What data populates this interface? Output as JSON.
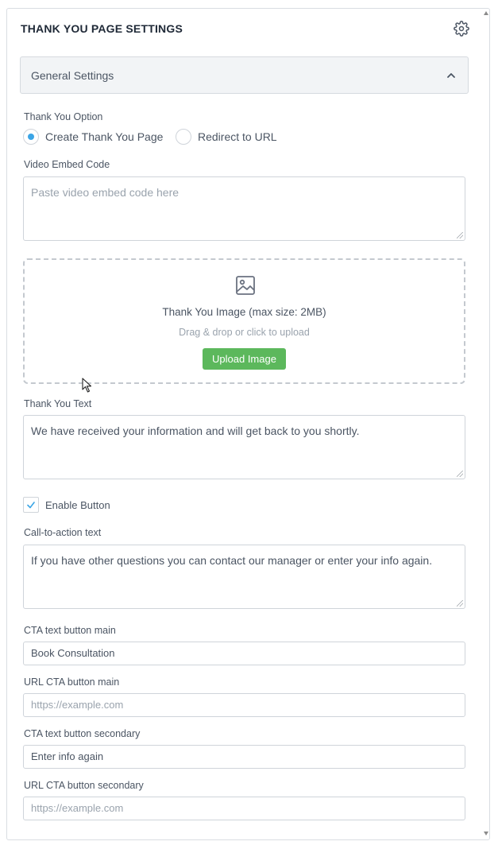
{
  "header": {
    "title": "THANK YOU PAGE SETTINGS",
    "settings_icon": "gear-icon"
  },
  "section": {
    "title": "General Settings",
    "toggle_icon": "chevron-up-icon"
  },
  "thank_you_option": {
    "label": "Thank You Option",
    "options": [
      {
        "label": "Create Thank You Page",
        "selected": true
      },
      {
        "label": "Redirect to URL",
        "selected": false
      }
    ]
  },
  "video_embed": {
    "label": "Video Embed Code",
    "placeholder": "Paste video embed code here",
    "value": ""
  },
  "image_upload": {
    "icon": "image-icon",
    "title": "Thank You Image (max size: 2MB)",
    "hint": "Drag & drop or click to upload",
    "button_label": "Upload Image"
  },
  "thank_you_text": {
    "label": "Thank You Text",
    "value": "We have received your information and will get back to you shortly."
  },
  "enable_button": {
    "label": "Enable Button",
    "checked": true
  },
  "cta_text": {
    "label": "Call-to-action text",
    "value": "If you have other questions you can contact our manager or enter your info again."
  },
  "cta_main_text": {
    "label": "CTA text button main",
    "value": "Book Consultation"
  },
  "cta_main_url": {
    "label": "URL CTA button main",
    "placeholder": "https://example.com",
    "value": ""
  },
  "cta_secondary_text": {
    "label": "CTA text button secondary",
    "value": "Enter info again"
  },
  "cta_secondary_url": {
    "label": "URL CTA button secondary",
    "placeholder": "https://example.com",
    "value": ""
  },
  "colors": {
    "accent": "#3ba5e6",
    "upload_button": "#5cb85c"
  }
}
